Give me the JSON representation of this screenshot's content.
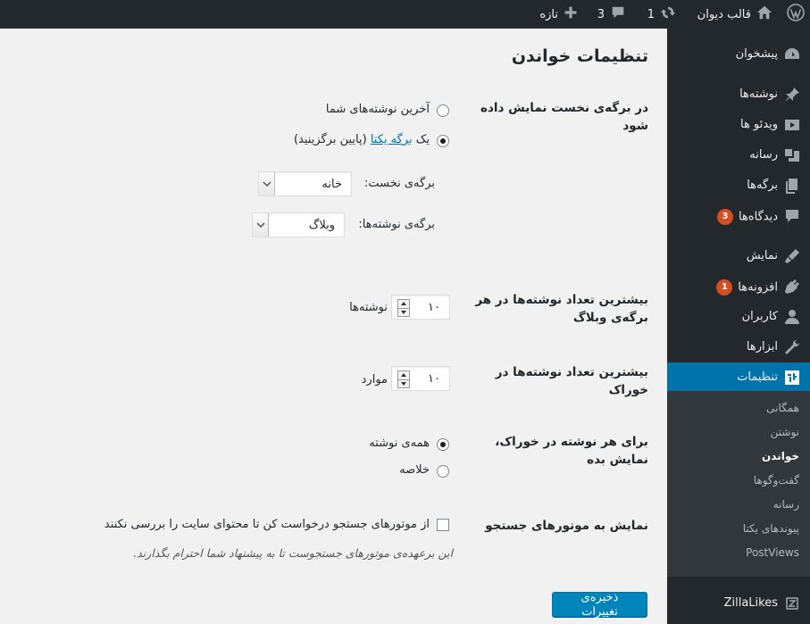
{
  "adminbar": {
    "site_name": "قالب دیوان",
    "updates_count": "1",
    "comments_count": "3",
    "new_label": "تازه"
  },
  "sidebar": {
    "items": [
      {
        "label": "پیشخوان",
        "icon": "dashboard-icon"
      },
      {
        "label": "نوشته‌ها",
        "icon": "pin-icon"
      },
      {
        "label": "ویدئو ها",
        "icon": "video-icon"
      },
      {
        "label": "رسانه",
        "icon": "media-icon"
      },
      {
        "label": "برگه‌ها",
        "icon": "pages-icon"
      },
      {
        "label": "دیدگاه‌ها",
        "icon": "comment-icon",
        "badge": "3"
      },
      {
        "label": "نمایش",
        "icon": "appearance-icon"
      },
      {
        "label": "افزونه‌ها",
        "icon": "plugin-icon",
        "badge": "1"
      },
      {
        "label": "کاربران",
        "icon": "users-icon"
      },
      {
        "label": "ابزارها",
        "icon": "tools-icon"
      },
      {
        "label": "تنظیمات",
        "icon": "settings-icon"
      },
      {
        "label": "ZillaLikes",
        "icon": "zillalikes-icon"
      }
    ],
    "submenu": [
      "همگانی",
      "نوشتن",
      "خواندن",
      "گفت‌وگوها",
      "رسانه",
      "پیوندهای یکتا",
      "PostViews"
    ]
  },
  "page": {
    "title": "تنظیمات خواندن",
    "front_page": {
      "label": "در برگه‌ی نخست نمایش داده شود",
      "option_latest": "آخرین نوشته‌های شما",
      "option_static_prefix": "یک",
      "option_static_link": "برگه یکتا",
      "option_static_suffix": "(پایین برگزینید)",
      "front_page_label": "برگه‌ی نخست:",
      "front_page_value": "خانه",
      "posts_page_label": "برگه‌ی نوشته‌ها:",
      "posts_page_value": "وبلاگ"
    },
    "posts_per_page": {
      "label": "بیشترین تعداد نوشته‌ها در هر برگه‌ی وبلاگ",
      "value": "۱۰",
      "unit": "نوشته‌ها"
    },
    "posts_per_rss": {
      "label": "بیشترین تعداد نوشته‌ها در خوراک",
      "value": "۱۰",
      "unit": "موارد"
    },
    "rss_use_excerpt": {
      "label": "برای هر نوشته در خوراک، نمایش بده",
      "option_full": "همه‌ی نوشته",
      "option_summary": "خلاصه"
    },
    "search_engine": {
      "label": "نمایش به موتورهای جستجو",
      "checkbox_label": "از موتورهای جستجو درخواست کن تا محتوای سایت را بررسی نکنند",
      "description": "این برعهده‌ی موتورهای جستجوست تا به پیشنهاد شما احترام بگذارند."
    },
    "save_button": "ذخیره‌ی تغییرات"
  }
}
